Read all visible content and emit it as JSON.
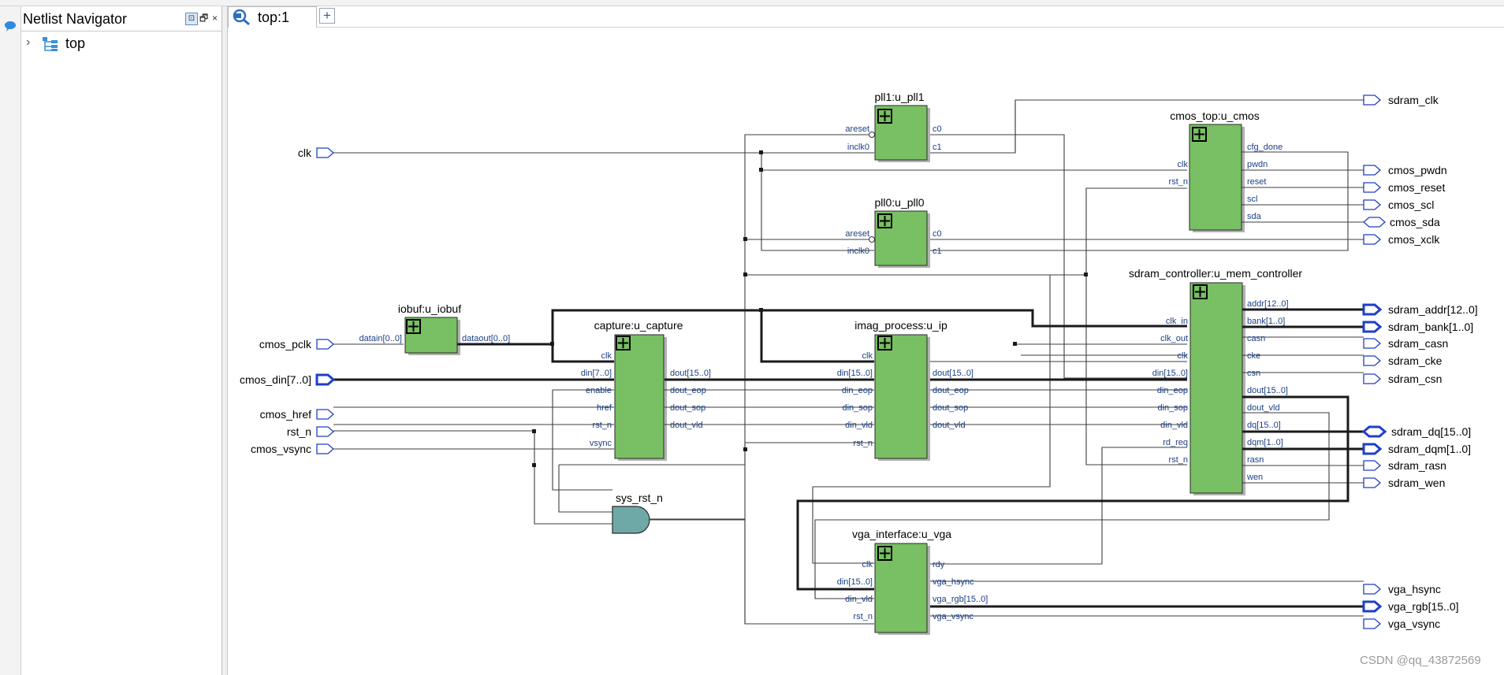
{
  "navigator": {
    "title": "Netlist Navigator",
    "pin": "⊡",
    "float": "🗗",
    "close": "×",
    "tree_root": "top"
  },
  "tabs": [
    {
      "label": "top:1"
    }
  ],
  "add_tab": "+",
  "watermark": "CSDN @qq_43872569",
  "colors": {
    "block_fill": "#78c063",
    "gate_fill": "#6fa9a7",
    "pin_color": "#1f3fc8",
    "port_text": "#1a3f85"
  },
  "ports": {
    "clk": "clk",
    "cmos_pclk": "cmos_pclk",
    "cmos_din": "cmos_din[7..0]",
    "cmos_href": "cmos_href",
    "rst_n": "rst_n",
    "cmos_vsync": "cmos_vsync",
    "sdram_clk": "sdram_clk",
    "cmos_pwdn": "cmos_pwdn",
    "cmos_reset": "cmos_reset",
    "cmos_scl": "cmos_scl",
    "cmos_sda": "cmos_sda",
    "cmos_xclk": "cmos_xclk",
    "sdram_addr": "sdram_addr[12..0]",
    "sdram_bank": "sdram_bank[1..0]",
    "sdram_casn": "sdram_casn",
    "sdram_cke": "sdram_cke",
    "sdram_csn": "sdram_csn",
    "sdram_dq": "sdram_dq[15..0]",
    "sdram_dqm": "sdram_dqm[1..0]",
    "sdram_rasn": "sdram_rasn",
    "sdram_wen": "sdram_wen",
    "vga_hsync": "vga_hsync",
    "vga_rgb": "vga_rgb[15..0]",
    "vga_vsync": "vga_vsync"
  },
  "blocks": {
    "pll1": {
      "title": "pll1:u_pll1",
      "in": [
        "areset",
        "inclk0"
      ],
      "out": [
        "c0",
        "c1"
      ]
    },
    "pll0": {
      "title": "pll0:u_pll0",
      "in": [
        "areset",
        "inclk0"
      ],
      "out": [
        "c0",
        "c1"
      ]
    },
    "cmos": {
      "title": "cmos_top:u_cmos",
      "in": [
        "clk",
        "rst_n"
      ],
      "out": [
        "cfg_done",
        "pwdn",
        "reset",
        "scl",
        "sda"
      ]
    },
    "iobuf": {
      "title": "iobuf:u_iobuf",
      "in": [
        "datain[0..0]"
      ],
      "out": [
        "dataout[0..0]"
      ]
    },
    "capture": {
      "title": "capture:u_capture",
      "in": [
        "clk",
        "din[7..0]",
        "enable",
        "href",
        "rst_n",
        "vsync"
      ],
      "out": [
        "dout[15..0]",
        "dout_eop",
        "dout_sop",
        "dout_vld"
      ]
    },
    "ip": {
      "title": "imag_process:u_ip",
      "in": [
        "clk",
        "din[15..0]",
        "din_eop",
        "din_sop",
        "din_vld",
        "rst_n"
      ],
      "out": [
        "dout[15..0]",
        "dout_eop",
        "dout_sop",
        "dout_vld"
      ]
    },
    "mem": {
      "title": "sdram_controller:u_mem_controller",
      "in": [
        "clk_in",
        "clk_out",
        "clk",
        "din[15..0]",
        "din_eop",
        "din_sop",
        "din_vld",
        "rd_req",
        "rst_n"
      ],
      "out": [
        "addr[12..0]",
        "bank[1..0]",
        "casn",
        "cke",
        "csn",
        "dout[15..0]",
        "dout_vld",
        "dq[15..0]",
        "dqm[1..0]",
        "rasn",
        "wen"
      ]
    },
    "vga": {
      "title": "vga_interface:u_vga",
      "in": [
        "clk",
        "din[15..0]",
        "din_vld",
        "rst_n"
      ],
      "out": [
        "rdy",
        "vga_hsync",
        "vga_rgb[15..0]",
        "vga_vsync"
      ]
    }
  },
  "gate": {
    "label": "sys_rst_n"
  }
}
